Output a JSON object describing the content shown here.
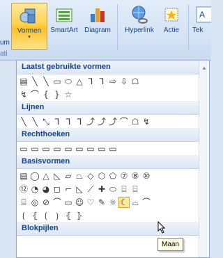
{
  "ribbon": {
    "left_partial": "um",
    "buttons": [
      {
        "label": "Vormen",
        "active": true
      },
      {
        "label": "SmartArt"
      },
      {
        "label": "Diagram"
      },
      {
        "label": "Hyperlink"
      },
      {
        "label": "Actie"
      },
      {
        "label": "Tek"
      }
    ],
    "group_partial": "ati"
  },
  "gallery": {
    "sections": [
      {
        "title": "Laatst gebruikte vormen",
        "rows": [
          [
            "▤",
            "╲",
            "╲",
            "▭",
            "⬭",
            "△",
            "⅂",
            "⅂",
            "⇨",
            "⇩",
            "☖"
          ],
          [
            "↯",
            "⌒",
            "{",
            "}",
            "☆"
          ]
        ]
      },
      {
        "title": "Lijnen",
        "rows": [
          [
            "╲",
            "╲",
            "⤡",
            "⅂",
            "⅂",
            "⅂",
            "⤴",
            "⤴",
            "⤴",
            "⌒",
            "☖",
            "↯"
          ]
        ]
      },
      {
        "title": "Rechthoeken",
        "rows": [
          [
            "▭",
            "▭",
            "▭",
            "▭",
            "▭",
            "▭",
            "▭",
            "▭",
            "▭"
          ]
        ]
      },
      {
        "title": "Basisvormen",
        "rows": [
          [
            "▤",
            "◯",
            "△",
            "◺",
            "▱",
            "⏢",
            "◇",
            "⬡",
            "⬠",
            "⑦",
            "⑧",
            "⑩"
          ],
          [
            "⑫",
            "◔",
            "◕",
            "◻",
            "⌐",
            "◺",
            "⟋",
            "✚",
            "⬭",
            "⌸",
            "⌸"
          ],
          [
            "⌸",
            "◎",
            "⊘",
            "⌒",
            "▭",
            "☺",
            "♡",
            "✎",
            "☼",
            "☾",
            "⌓",
            "⌒"
          ],
          [
            "⟮",
            "⦃",
            "⟮",
            "⟯",
            "⦃",
            "⦄"
          ]
        ]
      },
      {
        "title": "Blokpijlen",
        "rows": []
      }
    ],
    "selected_row": [
      3,
      2
    ],
    "selected_index": 9
  },
  "tooltip": "Maan"
}
